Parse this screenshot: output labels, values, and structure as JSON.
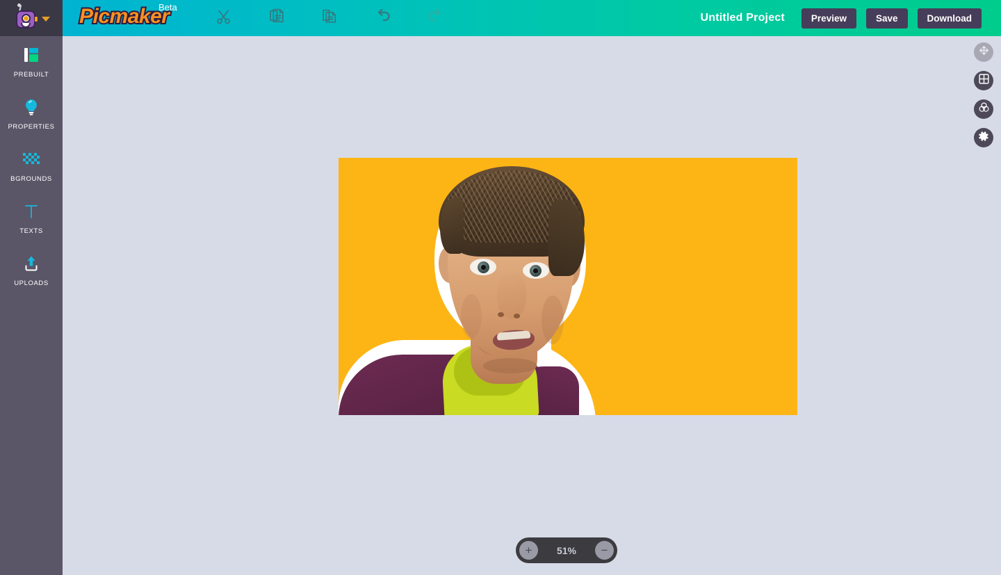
{
  "app": {
    "brand_name": "Picmaker",
    "brand_badge": "Beta",
    "logo_icon": "robot-mascot-icon",
    "logo_dropdown_icon": "chevron-down-icon",
    "colors": {
      "brand_orange": "#f79021",
      "brand_outline": "#2e1b3f",
      "header_gradient_start": "#00b4d2",
      "header_gradient_end": "#00cc8c",
      "sidebar_bg": "#5a5667",
      "logo_block_bg": "#3b3846",
      "workspace_bg": "#d7dbe7",
      "button_bg": "#453d59",
      "canvas_bg": "#fdb515",
      "accent_teal": "#00b9d4",
      "accent_green": "#00d57f"
    }
  },
  "sidebar": {
    "items": [
      {
        "label": "PREBUILT",
        "icon": "layout-template-icon"
      },
      {
        "label": "PROPERTIES",
        "icon": "lightbulb-icon"
      },
      {
        "label": "BGROUNDS",
        "icon": "checkerboard-icon"
      },
      {
        "label": "TEXTS",
        "icon": "text-t-icon"
      },
      {
        "label": "UPLOADS",
        "icon": "upload-icon"
      }
    ]
  },
  "header": {
    "tools": [
      {
        "name": "cut",
        "label": "Cut",
        "icon": "scissors-icon"
      },
      {
        "name": "copy",
        "label": "Copy",
        "icon": "copy-icon"
      },
      {
        "name": "paste",
        "label": "Paste",
        "icon": "paste-icon"
      },
      {
        "name": "undo",
        "label": "Undo",
        "icon": "undo-arrow-icon"
      },
      {
        "name": "redo",
        "label": "Redo",
        "icon": "redo-arrow-icon"
      }
    ],
    "project_title": "Untitled Project",
    "preview_label": "Preview",
    "save_label": "Save",
    "download_label": "Download"
  },
  "right_tools": [
    {
      "name": "move",
      "icon": "move-arrows-icon",
      "state": "disabled"
    },
    {
      "name": "layout",
      "icon": "grid-layout-icon",
      "state": "enabled"
    },
    {
      "name": "colors",
      "icon": "color-wheel-icon",
      "state": "enabled"
    },
    {
      "name": "settings",
      "icon": "gear-icon",
      "state": "enabled"
    }
  ],
  "zoom": {
    "value": "51%",
    "increase_label": "+",
    "decrease_label": "−"
  },
  "canvas": {
    "background_color": "#fdb515",
    "content_description": "cut-out photo of a surprised man with white sticker outline"
  }
}
